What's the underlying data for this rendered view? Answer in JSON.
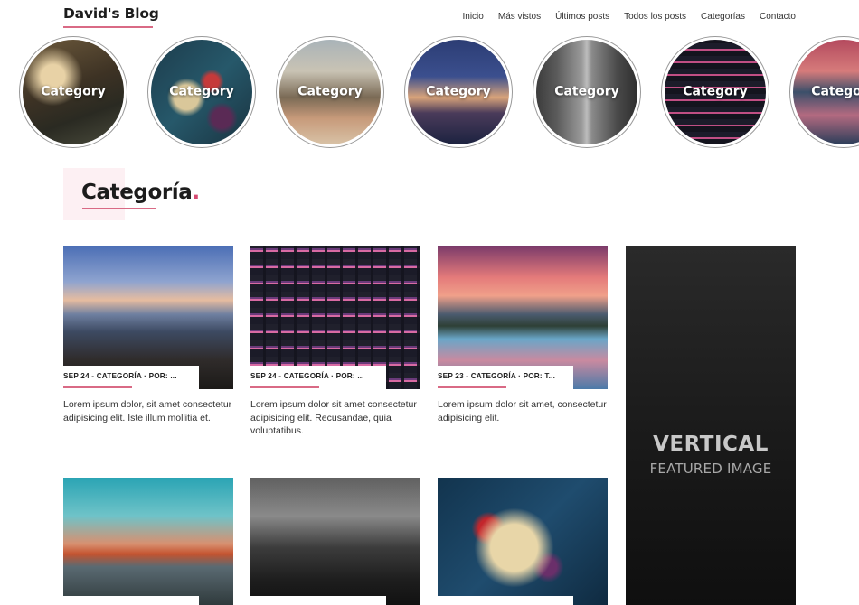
{
  "header": {
    "logo": "David's Blog",
    "nav": [
      "Inicio",
      "Más vistos",
      "Últimos posts",
      "Todos los posts",
      "Categorías",
      "Contacto"
    ]
  },
  "categories": [
    {
      "label": "Category"
    },
    {
      "label": "Category"
    },
    {
      "label": "Category"
    },
    {
      "label": "Category"
    },
    {
      "label": "Category"
    },
    {
      "label": "Category"
    },
    {
      "label": "Category"
    }
  ],
  "section": {
    "title": "Categoría",
    "dot": "."
  },
  "posts": [
    {
      "meta": "SEP 24 - CATEGORÍA · POR: ...",
      "text": "Lorem ipsum dolor, sit amet consectetur adipisicing elit. Iste illum mollitia et."
    },
    {
      "meta": "SEP 24 - CATEGORÍA · POR: ...",
      "text": "Lorem ipsum dolor sit amet consectetur adipisicing elit. Recusandae, quia voluptatibus."
    },
    {
      "meta": "SEP 23 - CATEGORÍA · POR: T...",
      "text": "Lorem ipsum dolor sit amet, consectetur adipisicing elit."
    },
    {
      "meta": "",
      "text": ""
    },
    {
      "meta": "",
      "text": ""
    },
    {
      "meta": "",
      "text": ""
    }
  ],
  "featured": {
    "title": "VERTICAL",
    "subtitle": "FEATURED IMAGE"
  }
}
